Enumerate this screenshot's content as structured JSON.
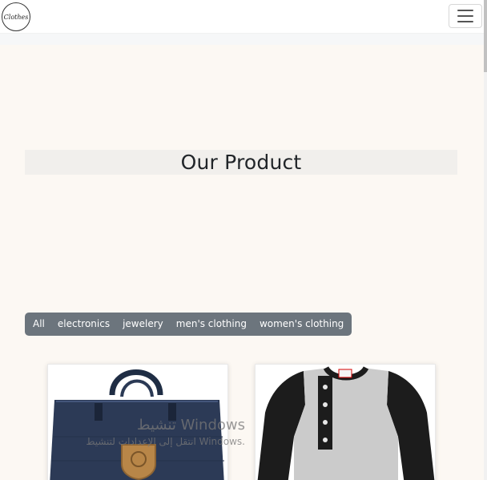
{
  "navbar": {
    "logo_text": "Clothes",
    "menu_icon": "hamburger-menu-icon"
  },
  "section": {
    "title": "Our Product"
  },
  "filters": [
    {
      "label": "All"
    },
    {
      "label": "electronics"
    },
    {
      "label": "jewelery"
    },
    {
      "label": "men's clothing"
    },
    {
      "label": "women's clothing"
    }
  ],
  "products": [
    {
      "image": "navy-backpack-image"
    },
    {
      "image": "raglan-henley-shirt-image"
    }
  ],
  "watermark": {
    "title": "تنشيط Windows",
    "subtitle": "انتقل إلى الإعدادات لتنشيط Windows."
  },
  "colors": {
    "page_bg": "#fcf8f3",
    "filter_bg": "#6c757d",
    "title_band": "#f1efec"
  }
}
